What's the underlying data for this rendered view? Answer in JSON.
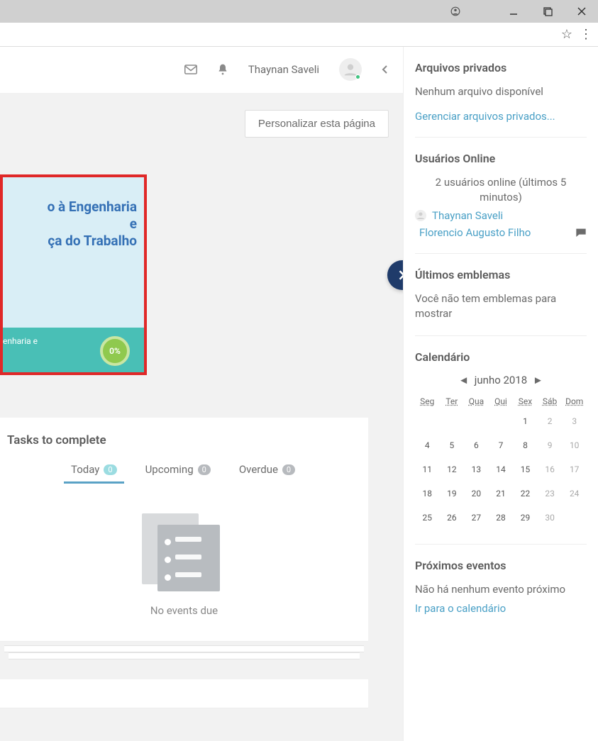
{
  "header": {
    "username": "Thaynan Saveli"
  },
  "main": {
    "customize_label": "Personalizar esta página",
    "course": {
      "title_line1": "o à Engenharia",
      "title_line2": "e",
      "title_line3": "ça do Trabalho",
      "footer_text": "enharia e",
      "progress": "0%"
    },
    "tasks": {
      "title": "Tasks to complete",
      "tabs": [
        {
          "label": "Today",
          "count": "0"
        },
        {
          "label": "Upcoming",
          "count": "0"
        },
        {
          "label": "Overdue",
          "count": "0"
        }
      ],
      "empty": "No events due"
    }
  },
  "sidebar": {
    "files": {
      "title": "Arquivos privados",
      "none": "Nenhum arquivo disponível",
      "manage": "Gerenciar arquivos privados..."
    },
    "online": {
      "title": "Usuários Online",
      "summary": "2 usuários online (últimos 5 minutos)",
      "user1": "Thaynan Saveli",
      "user2": "Florencio Augusto Filho"
    },
    "badges": {
      "title": "Últimos emblemas",
      "none": "Você não tem emblemas para mostrar"
    },
    "calendar": {
      "title": "Calendário",
      "month": "junho 2018",
      "days": [
        "Seg",
        "Ter",
        "Qua",
        "Qui",
        "Sex",
        "Sáb",
        "Dom"
      ],
      "weeks": [
        [
          "",
          "",
          "",
          "",
          "1",
          "2",
          "3"
        ],
        [
          "4",
          "5",
          "6",
          "7",
          "8",
          "9",
          "10"
        ],
        [
          "11",
          "12",
          "13",
          "14",
          "15",
          "16",
          "17"
        ],
        [
          "18",
          "19",
          "20",
          "21",
          "22",
          "23",
          "24"
        ],
        [
          "25",
          "26",
          "27",
          "28",
          "29",
          "30",
          ""
        ]
      ]
    },
    "upcoming": {
      "title": "Próximos eventos",
      "none": "Não há nenhum evento próximo",
      "link": "Ir para o calendário"
    }
  }
}
